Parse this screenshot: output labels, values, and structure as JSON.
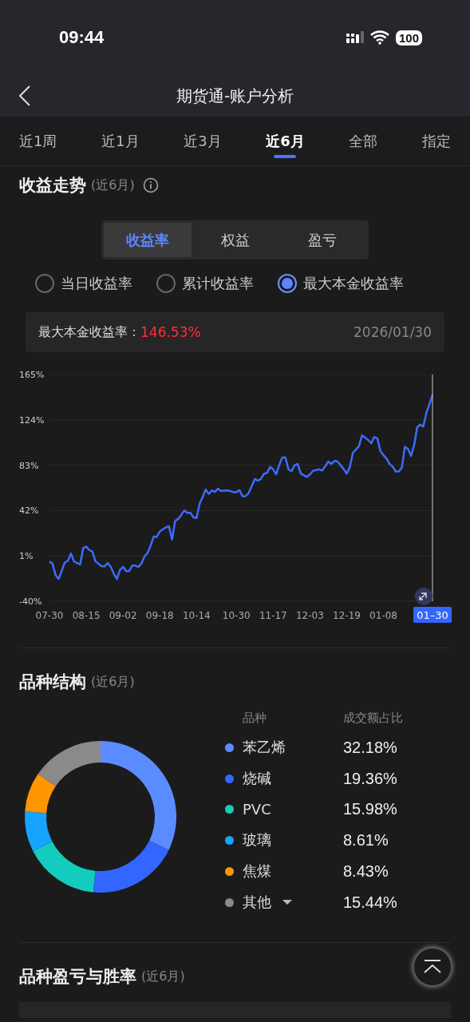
{
  "status_bar": {
    "time": "09:44",
    "battery": "100"
  },
  "header": {
    "title": "期货通-账户分析"
  },
  "period_tabs": [
    {
      "label": "近1周",
      "selected": false
    },
    {
      "label": "近1月",
      "selected": false
    },
    {
      "label": "近3月",
      "selected": false
    },
    {
      "label": "近6月",
      "selected": true
    },
    {
      "label": "全部",
      "selected": false
    },
    {
      "label": "指定",
      "selected": false
    }
  ],
  "return_trend": {
    "title": "收益走势",
    "period": "(近6月)",
    "segments": [
      {
        "label": "收益率",
        "selected": true
      },
      {
        "label": "权益",
        "selected": false
      },
      {
        "label": "盈亏",
        "selected": false
      }
    ],
    "options": [
      {
        "label": "当日收益率",
        "selected": false
      },
      {
        "label": "累计收益率",
        "selected": false
      },
      {
        "label": "最大本金收益率",
        "selected": true
      }
    ],
    "readout": {
      "label": "最大本金收益率：",
      "value": "146.53%",
      "date": "2026/01/30"
    },
    "chart_data": {
      "type": "line",
      "categories": [
        "07-30",
        null,
        null,
        null,
        null,
        null,
        null,
        null,
        null,
        null,
        null,
        null,
        "08-15",
        null,
        null,
        null,
        null,
        null,
        null,
        null,
        null,
        null,
        null,
        null,
        "09-02",
        null,
        null,
        null,
        null,
        null,
        null,
        null,
        null,
        null,
        null,
        null,
        "09-18",
        null,
        null,
        null,
        null,
        null,
        null,
        null,
        null,
        null,
        null,
        null,
        "10-14",
        null,
        null,
        null,
        null,
        null,
        null,
        null,
        null,
        null,
        null,
        null,
        null,
        "10-30",
        null,
        null,
        null,
        null,
        null,
        null,
        null,
        null,
        null,
        null,
        null,
        "11-17",
        null,
        null,
        null,
        null,
        null,
        null,
        null,
        null,
        null,
        null,
        null,
        "12-03",
        null,
        null,
        null,
        null,
        null,
        null,
        null,
        null,
        null,
        null,
        null,
        "12-19",
        null,
        null,
        null,
        null,
        null,
        null,
        null,
        null,
        null,
        null,
        null,
        "01-08",
        null,
        null,
        null,
        null,
        null,
        null,
        null,
        null,
        null,
        null,
        null,
        null,
        null,
        null,
        null,
        "01–30"
      ],
      "series": [
        {
          "color": "#3d6bff",
          "values": [
            -4.1,
            -6,
            -16.4,
            -19.9,
            -12.5,
            -5,
            -3.6,
            3.2,
            -4,
            -5.4,
            -6.8,
            8.1,
            9.4,
            6.2,
            4.8,
            -4,
            -6.1,
            -8.2,
            -8.5,
            -5.5,
            -8.8,
            -15,
            -19.9,
            -11.7,
            -8.8,
            -12.8,
            -12.8,
            -7.7,
            -7.7,
            -9,
            -6,
            0.5,
            3.5,
            10.2,
            18.4,
            18.1,
            23,
            25,
            26.8,
            27.6,
            15.7,
            32.5,
            34.4,
            38,
            42,
            40,
            40,
            35.8,
            35.2,
            48.3,
            54.2,
            61,
            57,
            60.2,
            58.8,
            61.8,
            59.7,
            60,
            60.2,
            59.7,
            58.6,
            58.6,
            60.5,
            55,
            55,
            57.8,
            64,
            70.5,
            68.9,
            70.5,
            75.1,
            76,
            81.4,
            79.2,
            74.6,
            83.3,
            90,
            90,
            79.2,
            77.6,
            83,
            84.1,
            75.4,
            74,
            72.4,
            74.6,
            77.8,
            78.5,
            79.2,
            78.1,
            82,
            86.3,
            84.1,
            86.8,
            86.3,
            83,
            79.5,
            75.4,
            80.8,
            94.1,
            97,
            100.1,
            109.9,
            108,
            105.8,
            102.8,
            108.5,
            107.2,
            95.8,
            92,
            89,
            84.1,
            81.7,
            77.3,
            77.3,
            80.6,
            99.6,
            97.7,
            91.4,
            101.2,
            117.2,
            119.7,
            118,
            130.2,
            138,
            146.5
          ]
        }
      ],
      "ylim": [
        -40,
        165
      ],
      "yticks": [
        {
          "value": -40,
          "label": "-40%"
        },
        {
          "value": 1,
          "label": "1%"
        },
        {
          "value": 42,
          "label": "42%"
        },
        {
          "value": 83,
          "label": "83%"
        },
        {
          "value": 124,
          "label": "124%"
        },
        {
          "value": 165,
          "label": "165%"
        }
      ],
      "grid": true
    }
  },
  "variety_structure": {
    "title": "品种结构",
    "period": "(近6月)",
    "columns": [
      "品种",
      "成交额占比"
    ],
    "items": [
      {
        "name": "苯乙烯",
        "share": "32.18%",
        "color": "#5b8cff"
      },
      {
        "name": "烧碱",
        "share": "19.36%",
        "color": "#3366ff"
      },
      {
        "name": "PVC",
        "share": "15.98%",
        "color": "#14ccbe"
      },
      {
        "name": "玻璃",
        "share": "8.61%",
        "color": "#17a4ff"
      },
      {
        "name": "焦煤",
        "share": "8.43%",
        "color": "#ff9500"
      },
      {
        "name": "其他",
        "share": "15.44%",
        "color": "#8a8a8a",
        "expandable": true
      }
    ],
    "chart_data": {
      "type": "donut",
      "values": [
        32.18,
        19.36,
        15.98,
        8.61,
        8.43,
        15.44
      ]
    }
  },
  "variety_pnl": {
    "title": "品种盈亏与胜率",
    "period": "(近6月)"
  }
}
